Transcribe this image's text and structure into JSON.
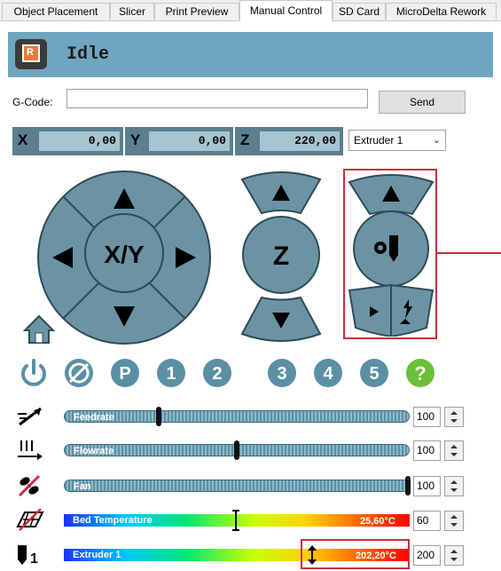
{
  "tabs": [
    {
      "label": "Object Placement",
      "active": false
    },
    {
      "label": "Slicer",
      "active": false
    },
    {
      "label": "Print Preview",
      "active": false
    },
    {
      "label": "Manual Control",
      "active": true
    },
    {
      "label": "SD Card",
      "active": false
    },
    {
      "label": "MicroDelta Rework",
      "active": false
    }
  ],
  "status": {
    "text": "Idle",
    "logo_letter": "R"
  },
  "gcode": {
    "label": "G-Code:",
    "value": "",
    "send_label": "Send"
  },
  "coords": {
    "x_label": "X",
    "x_value": "0,00",
    "y_label": "Y",
    "y_value": "0,00",
    "z_label": "Z",
    "z_value": "220,00"
  },
  "extruder_select": {
    "value": "Extruder 1"
  },
  "jog": {
    "xy_label": "X/Y",
    "z_label": "Z"
  },
  "icons": {
    "power": "power-icon",
    "fan_off": "fan-off-icon",
    "park": "park-icon",
    "n1": "1",
    "n2": "2",
    "n3": "3",
    "n4": "4",
    "n5": "5",
    "help": "?"
  },
  "sliders": {
    "feedrate": {
      "label": "Feedrate",
      "value": "100",
      "level": 0.27
    },
    "flowrate": {
      "label": "Flowrate",
      "value": "100",
      "level": 0.5
    },
    "fan": {
      "label": "Fan",
      "value": "100",
      "level": 1.0
    },
    "bed": {
      "label": "Bed Temperature",
      "reading": "25,60°C",
      "value": "60",
      "level": 0.5
    },
    "extruder": {
      "label": "Extruder 1",
      "reading": "202,20°C",
      "value": "200",
      "level": 0.72
    }
  },
  "colors": {
    "accent": "#6fa6bf",
    "highlight": "#cc2e3b",
    "button": "#6b93a3"
  }
}
